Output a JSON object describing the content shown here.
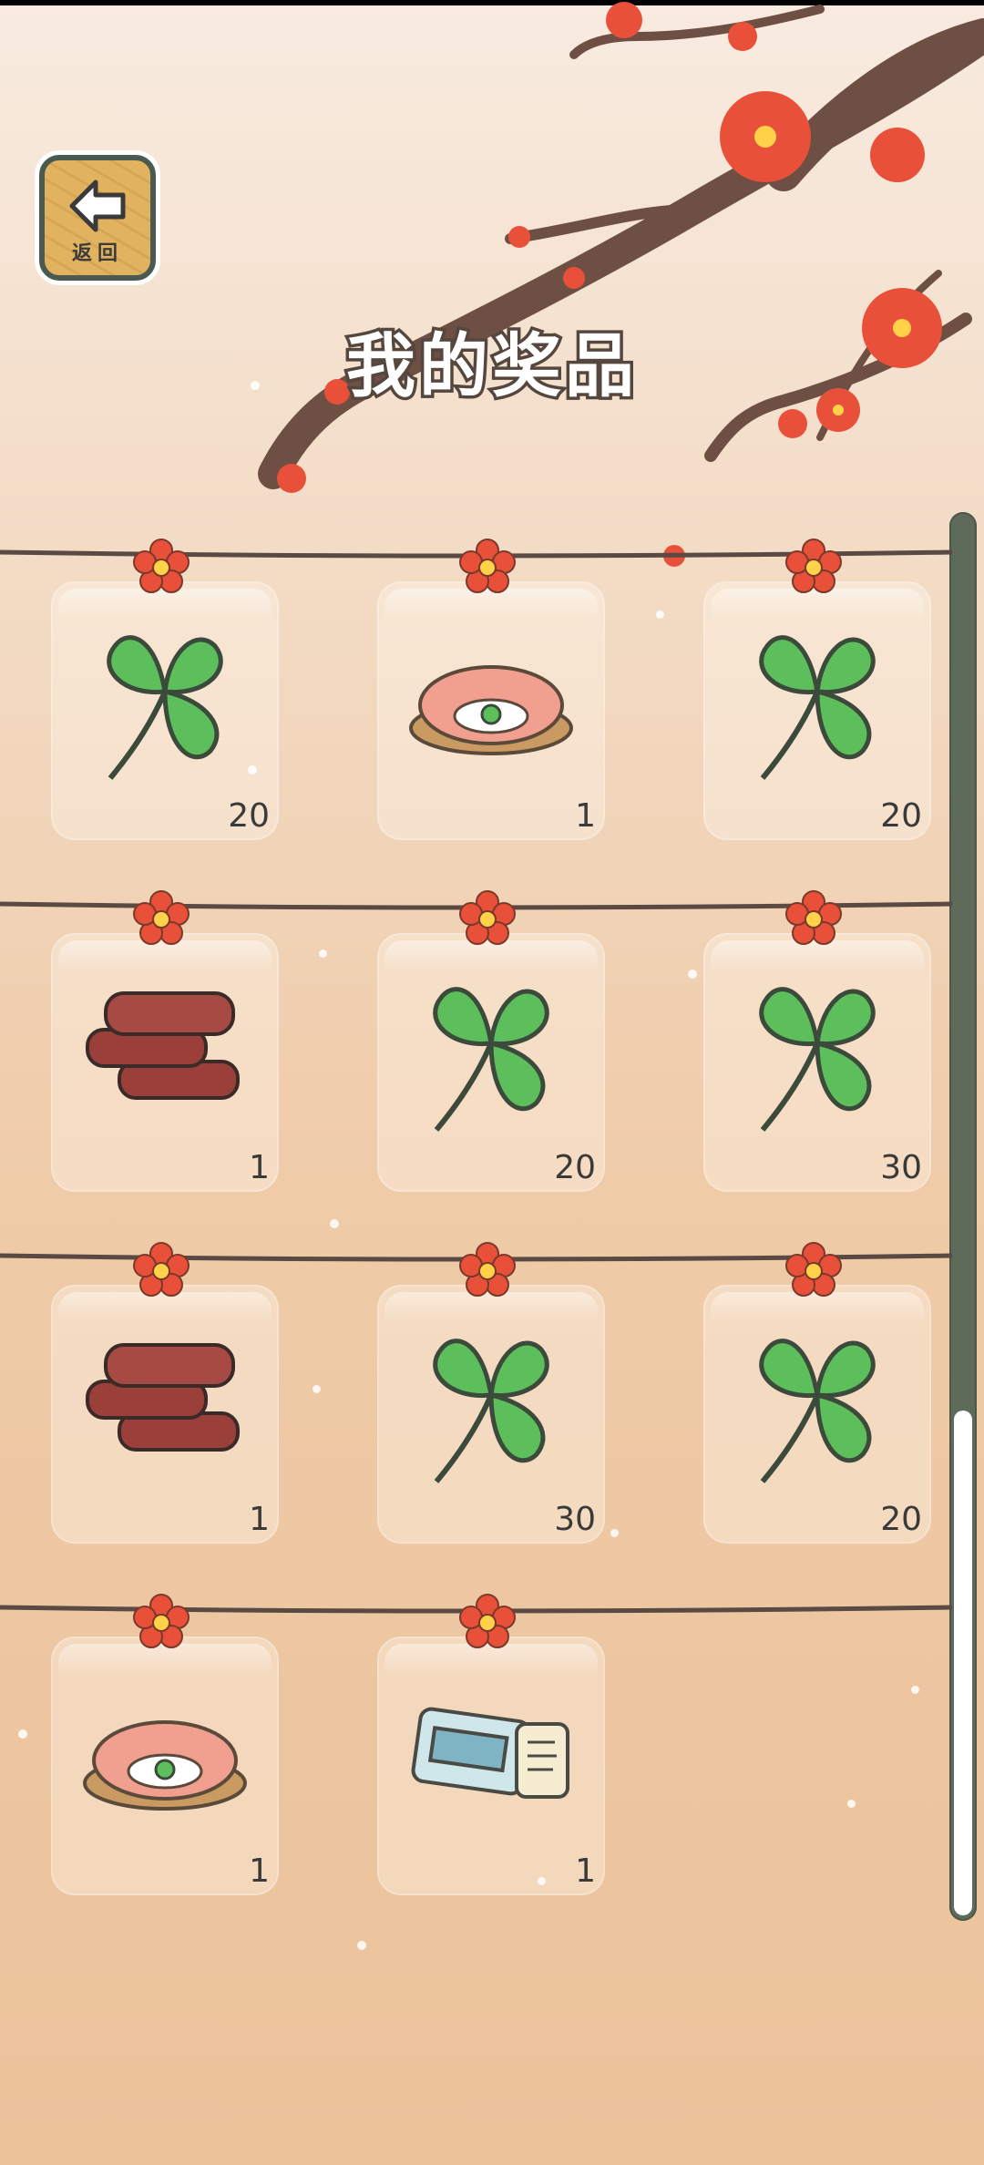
{
  "app": {
    "title": "我的奖品",
    "back_label": "返回",
    "accent_colors": {
      "frame": "#4b5a50",
      "flower": "#e8503a",
      "clover": "#5cbf5b",
      "wood": "#e2b35f"
    }
  },
  "prizes": [
    {
      "name": "clover",
      "count": "20"
    },
    {
      "name": "shrimp-dish",
      "count": "1"
    },
    {
      "name": "clover",
      "count": "20"
    },
    {
      "name": "dried-meat",
      "count": "1"
    },
    {
      "name": "clover",
      "count": "20"
    },
    {
      "name": "clover",
      "count": "30"
    },
    {
      "name": "dried-meat",
      "count": "1"
    },
    {
      "name": "clover",
      "count": "30"
    },
    {
      "name": "clover",
      "count": "20"
    },
    {
      "name": "shrimp-dish",
      "count": "1"
    },
    {
      "name": "ticket",
      "count": "1"
    }
  ],
  "icons": {
    "back": "arrow-left-icon",
    "decoration": "plum-blossom-icon"
  }
}
